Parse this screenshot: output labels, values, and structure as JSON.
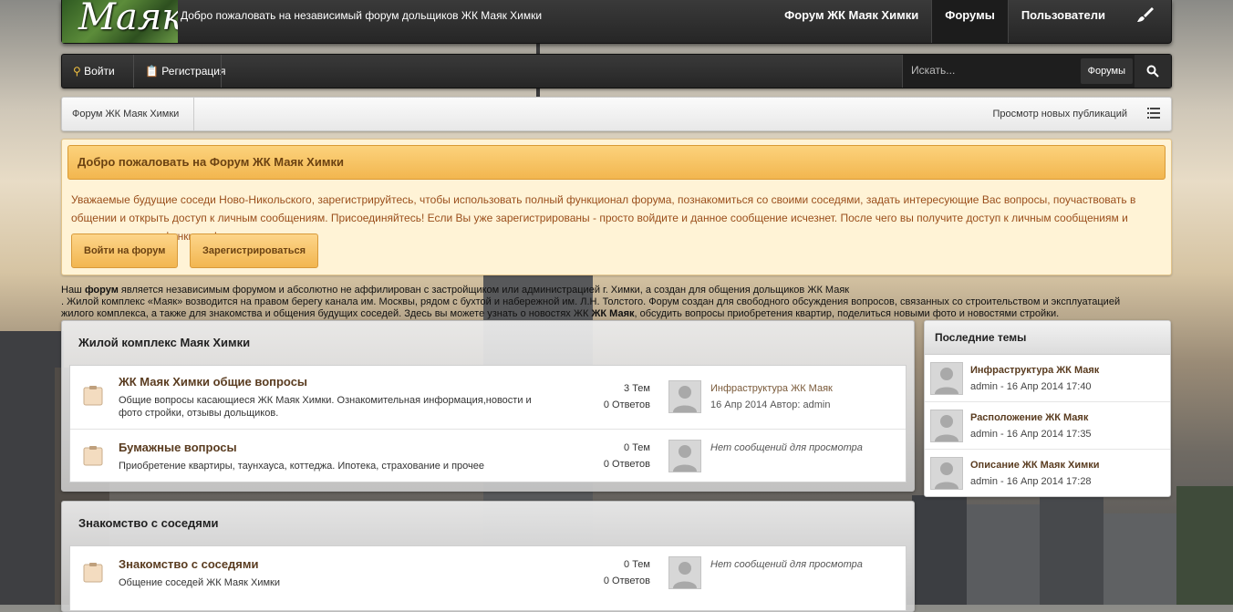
{
  "header": {
    "logo_text": "Маяк",
    "welcome": "Добро пожаловать на независимый форум дольщиков ЖК Маяк Химки",
    "nav": [
      "Форум ЖК Маяк Химки",
      "Форумы",
      "Пользователи"
    ]
  },
  "userbar": {
    "login": "Войти",
    "register": "Регистрация",
    "search_placeholder": "Искать...",
    "search_scope": "Форумы"
  },
  "breadcrumb": {
    "home": "Форум ЖК Маяк Химки",
    "new_posts": "Просмотр новых публикаций"
  },
  "notice": {
    "title": "Добро пожаловать на Форум ЖК Маяк Химки",
    "text": "Уважаемые будущие соседи Ново-Никольского, зарегистрируйтесь, чтобы использовать полный функционал форума, познакомиться со своими соседями, задать интересующие Вас вопросы, поучаствовать в общении и открыть доступ к личным сообщениям. Присоединяйтесь! Если Вы уже зарегистрированы - просто войдите и данное сообщение исчезнет. После чего вы получите доступ к личным сообщениям и другим полезным функциям!",
    "login_btn": "Войти на форум",
    "register_btn": "Зарегистрироваться"
  },
  "about": {
    "line1_prefix": "Наш ",
    "line1_bold": "форум",
    "line1_rest": " является независимым форумом и абсолютно не аффилирован с застройщиком или администрацией г. Химки, а создан для общения дольщиков ЖК Маяк",
    "line2": ". Жилой комплекс «Маяк» возводится на правом берегу канала им. Москвы, рядом с бухтой и набережной им. Л.Н. Толстого. Форум создан для свободного обсуждения вопросов, связанных со строительством и эксплуатацией",
    "line3_prefix": "жилого комплекса, а также для знакомства и общения будущих соседей. Здесь вы можете узнать о новостях ЖК ",
    "line3_bold": "ЖК Маяк",
    "line3_rest": ", обсудить вопросы приобретения квартир, поделиться новыми фото и новостями стройки."
  },
  "categories": [
    {
      "title": "Жилой комплекс Маяк Химки",
      "forums": [
        {
          "name": "ЖК Маяк Химки общие вопросы",
          "desc": "Общие вопросы касающиеся ЖК Маяк Химки. Ознакомительная информация,новости и фото стройки, отзывы дольщиков.",
          "topics": "3 Тем",
          "replies": "0 Ответов",
          "last_title": "Инфраструктура ЖК Маяк",
          "last_meta": "16 Апр 2014 Автор: admin"
        },
        {
          "name": "Бумажные вопросы",
          "desc": "Приобретение квартиры, таунхауса, коттеджа. Ипотека, страхование и прочее",
          "topics": "0 Тем",
          "replies": "0 Ответов",
          "no_posts": "Нет сообщений для просмотра"
        }
      ]
    },
    {
      "title": "Знакомство с соседями",
      "forums": [
        {
          "name": "Знакомство с соседями",
          "desc": "Общение соседей ЖК Маяк Химки",
          "topics": "0 Тем",
          "replies": "0 Ответов",
          "no_posts": "Нет сообщений для просмотра"
        }
      ]
    }
  ],
  "sidebar": {
    "title": "Последние темы",
    "items": [
      {
        "title": "Инфраструктура ЖК Маяк",
        "meta": "admin - 16 Апр 2014 17:40"
      },
      {
        "title": "Расположение ЖК Маяк",
        "meta": "admin - 16 Апр 2014 17:35"
      },
      {
        "title": "Описание ЖК Маяк Химки",
        "meta": "admin - 16 Апр 2014 17:28"
      }
    ]
  }
}
